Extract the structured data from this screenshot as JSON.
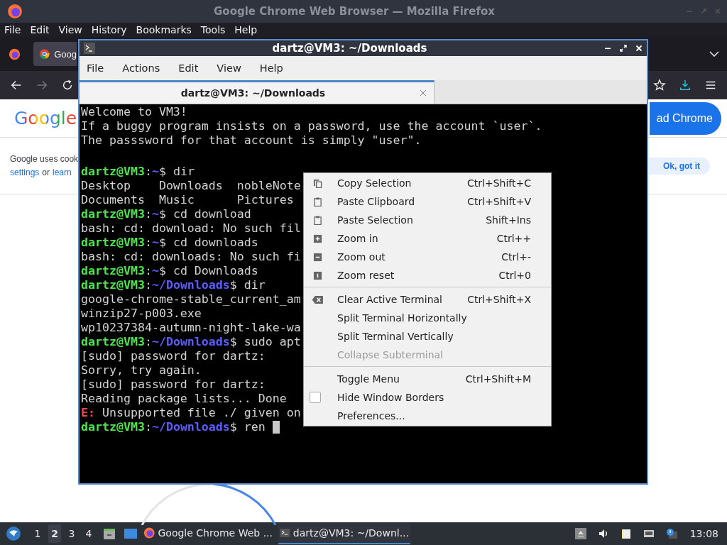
{
  "firefox": {
    "title": "Google Chrome Web Browser — Mozilla Firefox",
    "menu": [
      "File",
      "Edit",
      "View",
      "History",
      "Bookmarks",
      "Tools",
      "Help"
    ],
    "tab": "Goog",
    "page": {
      "logo": "Google",
      "download_button": "ad Chrome",
      "cookie_line_1": "Google uses cook",
      "cookie_link_1": "settings",
      "cookie_between": "or",
      "cookie_link_2": "learn",
      "ok_button": "Ok, got it"
    }
  },
  "terminal": {
    "title": "dartz@VM3: ~/Downloads",
    "menu": [
      "File",
      "Actions",
      "Edit",
      "View",
      "Help"
    ],
    "tabs": [
      {
        "label": "dartz@VM3: ~/Downloads",
        "selected": true
      }
    ],
    "lines": [
      {
        "kind": "text",
        "segments": [
          {
            "kind": "plain",
            "text": "Welcome to VM3!"
          }
        ]
      },
      {
        "kind": "text",
        "segments": [
          {
            "kind": "plain",
            "text": "If a buggy program insists on a password, use the account `user`."
          }
        ]
      },
      {
        "kind": "text",
        "segments": [
          {
            "kind": "plain",
            "text": "The passsword for that account is simply \"user\"."
          }
        ]
      },
      {
        "kind": "blank"
      },
      {
        "kind": "text",
        "segments": [
          {
            "kind": "user",
            "text": "dartz@VM3"
          },
          {
            "kind": "plain",
            "text": ":"
          },
          {
            "kind": "path",
            "text": "~"
          },
          {
            "kind": "plain",
            "text": "$ dir"
          }
        ]
      },
      {
        "kind": "text",
        "segments": [
          {
            "kind": "plain",
            "text": "Desktop    Downloads  nobleNote"
          }
        ]
      },
      {
        "kind": "text",
        "segments": [
          {
            "kind": "plain",
            "text": "Documents  Music      Pictures"
          }
        ]
      },
      {
        "kind": "text",
        "segments": [
          {
            "kind": "user",
            "text": "dartz@VM3"
          },
          {
            "kind": "plain",
            "text": ":"
          },
          {
            "kind": "path",
            "text": "~"
          },
          {
            "kind": "plain",
            "text": "$ cd download"
          }
        ]
      },
      {
        "kind": "text",
        "segments": [
          {
            "kind": "plain",
            "text": "bash: cd: download: No such fil"
          }
        ]
      },
      {
        "kind": "text",
        "segments": [
          {
            "kind": "user",
            "text": "dartz@VM3"
          },
          {
            "kind": "plain",
            "text": ":"
          },
          {
            "kind": "path",
            "text": "~"
          },
          {
            "kind": "plain",
            "text": "$ cd downloads"
          }
        ]
      },
      {
        "kind": "text",
        "segments": [
          {
            "kind": "plain",
            "text": "bash: cd: downloads: No such fi"
          }
        ]
      },
      {
        "kind": "text",
        "segments": [
          {
            "kind": "user",
            "text": "dartz@VM3"
          },
          {
            "kind": "plain",
            "text": ":"
          },
          {
            "kind": "path",
            "text": "~"
          },
          {
            "kind": "plain",
            "text": "$ cd Downloads"
          }
        ]
      },
      {
        "kind": "text",
        "segments": [
          {
            "kind": "user",
            "text": "dartz@VM3"
          },
          {
            "kind": "plain",
            "text": ":"
          },
          {
            "kind": "path",
            "text": "~/Downloads"
          },
          {
            "kind": "plain",
            "text": "$ dir"
          }
        ]
      },
      {
        "kind": "text",
        "segments": [
          {
            "kind": "plain",
            "text": "google-chrome-stable_current_am"
          }
        ]
      },
      {
        "kind": "text",
        "segments": [
          {
            "kind": "plain",
            "text": "winzip27-p003.exe"
          }
        ]
      },
      {
        "kind": "text",
        "segments": [
          {
            "kind": "plain",
            "text": "wp10237384-autumn-night-lake-wa"
          }
        ]
      },
      {
        "kind": "text",
        "segments": [
          {
            "kind": "user",
            "text": "dartz@VM3"
          },
          {
            "kind": "plain",
            "text": ":"
          },
          {
            "kind": "path",
            "text": "~/Downloads"
          },
          {
            "kind": "plain",
            "text": "$ sudo apt"
          }
        ]
      },
      {
        "kind": "text",
        "segments": [
          {
            "kind": "plain",
            "text": "[sudo] password for dartz:"
          }
        ]
      },
      {
        "kind": "text",
        "segments": [
          {
            "kind": "plain",
            "text": "Sorry, try again."
          }
        ]
      },
      {
        "kind": "text",
        "segments": [
          {
            "kind": "plain",
            "text": "[sudo] password for dartz:"
          }
        ]
      },
      {
        "kind": "text",
        "segments": [
          {
            "kind": "plain",
            "text": "Reading package lists... Done"
          }
        ]
      },
      {
        "kind": "text",
        "segments": [
          {
            "kind": "error",
            "text": "E:"
          },
          {
            "kind": "plain",
            "text": " Unsupported file ./ given on"
          }
        ]
      },
      {
        "kind": "text",
        "cursor": true,
        "segments": [
          {
            "kind": "user",
            "text": "dartz@VM3"
          },
          {
            "kind": "plain",
            "text": ":"
          },
          {
            "kind": "path",
            "text": "~/Downloads"
          },
          {
            "kind": "plain",
            "text": "$ ren "
          }
        ]
      }
    ]
  },
  "context_menu": {
    "items": [
      {
        "kind": "action",
        "label": "Copy Selection",
        "shortcut": "Ctrl+Shift+C",
        "disabled": false
      },
      {
        "kind": "action",
        "label": "Paste Clipboard",
        "shortcut": "Ctrl+Shift+V",
        "disabled": false
      },
      {
        "kind": "action",
        "label": "Paste Selection",
        "shortcut": "Shift+Ins",
        "disabled": false
      },
      {
        "kind": "action",
        "label": "Zoom in",
        "shortcut": "Ctrl++",
        "disabled": false
      },
      {
        "kind": "action",
        "label": "Zoom out",
        "shortcut": "Ctrl+-",
        "disabled": false
      },
      {
        "kind": "action",
        "label": "Zoom reset",
        "shortcut": "Ctrl+0",
        "disabled": false
      },
      {
        "kind": "separator"
      },
      {
        "kind": "action",
        "label": "Clear Active Terminal",
        "shortcut": "Ctrl+Shift+X",
        "disabled": false
      },
      {
        "kind": "action",
        "label": "Split Terminal Horizontally",
        "disabled": false
      },
      {
        "kind": "action",
        "label": "Split Terminal Vertically",
        "disabled": false
      },
      {
        "kind": "action",
        "label": "Collapse Subterminal",
        "disabled": true
      },
      {
        "kind": "separator"
      },
      {
        "kind": "action",
        "label": "Toggle Menu",
        "shortcut": "Ctrl+Shift+M",
        "disabled": false
      },
      {
        "kind": "check",
        "label": "Hide Window Borders",
        "checked": false,
        "disabled": false
      },
      {
        "kind": "action",
        "label": "Preferences...",
        "disabled": false
      }
    ]
  },
  "taskbar": {
    "workspaces": [
      {
        "label": "1",
        "selected": false
      },
      {
        "label": "2",
        "selected": true
      },
      {
        "label": "3",
        "selected": false
      },
      {
        "label": "4",
        "selected": false
      }
    ],
    "tasks": [
      {
        "kind": "browser",
        "label": "Google Chrome Web ...",
        "selected": false
      },
      {
        "kind": "terminal",
        "label": "dartz@VM3: ~/Downl...",
        "selected": true
      }
    ],
    "clock": "13:08"
  }
}
